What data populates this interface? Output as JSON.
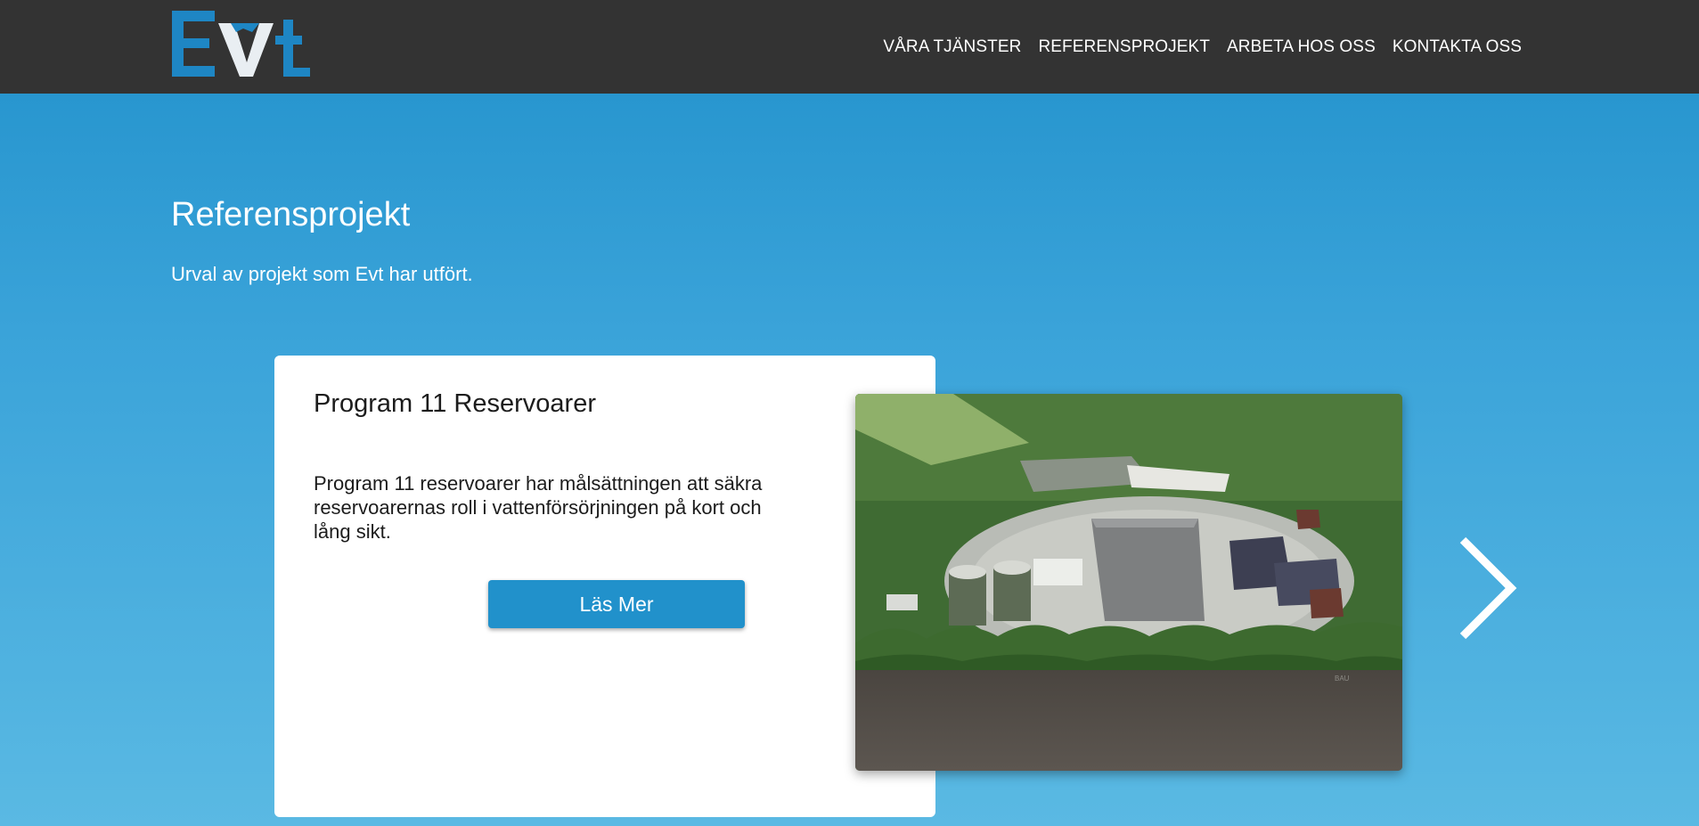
{
  "header": {
    "logo_text": "Evt",
    "nav": [
      {
        "label": "VÅRA TJÄNSTER"
      },
      {
        "label": "REFERENSPROJEKT"
      },
      {
        "label": "ARBETA HOS OSS"
      },
      {
        "label": "KONTAKTA OSS"
      }
    ]
  },
  "hero": {
    "title": "Referensprojekt",
    "subtitle": "Urval av projekt som Evt har utfört."
  },
  "slide": {
    "title": "Program 11 Reservoarer",
    "description": "Program 11 reservoarer har målsättningen att säkra reservoarernas roll i vattenförsörjningen på kort och lång sikt.",
    "button_label": "Läs Mer",
    "image_watermark": "BAU"
  },
  "carousel": {
    "next_icon": "chevron-right-icon"
  },
  "colors": {
    "topbar": "#333333",
    "accent": "#2191cb",
    "logo_blue": "#1e86c4"
  }
}
